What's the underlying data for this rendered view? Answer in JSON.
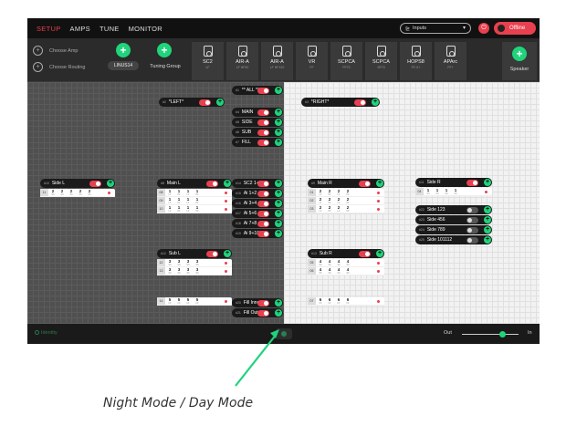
{
  "tabs": [
    {
      "label": "SETUP",
      "active": true
    },
    {
      "label": "AMPS",
      "active": false
    },
    {
      "label": "TUNE",
      "active": false
    },
    {
      "label": "MONITOR",
      "active": false
    }
  ],
  "header": {
    "inputs_select": "Inputs",
    "offline_label": "Offline"
  },
  "toolbar": {
    "choose_amp": "Choose Amp",
    "choose_routing": "Choose Routing",
    "linus_label": "LINUS14",
    "tuning_group": "Tuning Group",
    "speaker_label": "Speaker"
  },
  "speakers": [
    {
      "name": "SC2",
      "sub": "LF"
    },
    {
      "name": "AIR-A",
      "sub": "LF HF90"
    },
    {
      "name": "AIR-A",
      "sub": "LF HF120"
    },
    {
      "name": "VR",
      "sub": "FF"
    },
    {
      "name": "SCPCA",
      "sub": "FF70"
    },
    {
      "name": "SCPCA",
      "sub": "SF70"
    },
    {
      "name": "HOPS8",
      "sub": "FF-X+"
    },
    {
      "name": "APArc",
      "sub": "FF+"
    }
  ],
  "groups": {
    "all": {
      "num": "#1",
      "label": "** ALL **"
    },
    "left": {
      "num": "#2",
      "label": "*LEFT*"
    },
    "right": {
      "num": "#3",
      "label": "*RIGHT*"
    },
    "main": {
      "num": "#4",
      "label": "MAIN"
    },
    "side": {
      "num": "#5",
      "label": "SIDE"
    },
    "sub": {
      "num": "#6",
      "label": "SUB"
    },
    "fill": {
      "num": "#7",
      "label": "FILL"
    },
    "side_l": {
      "num": "#10",
      "label": "Side L"
    },
    "main_l": {
      "num": "#8",
      "label": "Main L"
    },
    "sc2_12": {
      "num": "#14",
      "label": "SC2 1+2"
    },
    "ai_12": {
      "num": "#15",
      "label": "Ai 1+2"
    },
    "ai_34": {
      "num": "#16",
      "label": "Ai 3+4"
    },
    "ai_56": {
      "num": "#17",
      "label": "Ai 5+6"
    },
    "ai_78": {
      "num": "#18",
      "label": "Ai 7+8"
    },
    "ai_910": {
      "num": "#19",
      "label": "Ai 9+10"
    },
    "main_r": {
      "num": "#9",
      "label": "Main R"
    },
    "side_r": {
      "num": "#11",
      "label": "Side R"
    },
    "side_123": {
      "num": "#22",
      "label": "Side 123"
    },
    "side_456": {
      "num": "#23",
      "label": "Side 456"
    },
    "side_789": {
      "num": "#24",
      "label": "Side 789"
    },
    "side_101112": {
      "num": "#25",
      "label": "Side 101112"
    },
    "sub_l": {
      "num": "#12",
      "label": "Sub L"
    },
    "sub_r": {
      "num": "#13",
      "label": "Sub R"
    },
    "fill_inner": {
      "num": "#20",
      "label": "Fill Inner"
    },
    "fill_outer": {
      "num": "#21",
      "label": "Fill Outer"
    }
  },
  "tables": {
    "side_l": [
      {
        "n": "11",
        "v": [
          "2",
          "2",
          "2",
          "2",
          "2"
        ],
        "s": [
          "SS",
          "SS",
          "SS",
          "SS",
          "SS"
        ]
      }
    ],
    "main_l": [
      {
        "n": "08",
        "v": [
          "1",
          "1",
          "1",
          "1"
        ],
        "s": [
          "LF",
          "HF",
          "LF",
          "HF"
        ]
      },
      {
        "n": "09",
        "v": [
          "1",
          "1",
          "1",
          "1"
        ],
        "s": [
          "LF",
          "HF",
          "LF",
          "HF"
        ]
      },
      {
        "n": "10",
        "v": [
          "1",
          "1",
          "1",
          "1"
        ],
        "s": [
          "LF",
          "HF",
          "LF",
          "HF"
        ]
      }
    ],
    "main_r": [
      {
        "n": "01",
        "v": [
          "2",
          "2",
          "2",
          "2"
        ],
        "s": [
          "LF",
          "HF",
          "LF",
          "HF"
        ]
      },
      {
        "n": "02",
        "v": [
          "2",
          "2",
          "2",
          "2"
        ],
        "s": [
          "LF",
          "HF",
          "LF",
          "HF"
        ]
      },
      {
        "n": "03",
        "v": [
          "2",
          "2",
          "2",
          "2"
        ],
        "s": [
          "LF",
          "HF",
          "LF",
          "HF"
        ]
      }
    ],
    "side_r": [
      {
        "n": "04",
        "v": [
          "1",
          "1",
          "1",
          "1"
        ],
        "s": [
          "SS",
          "SS",
          "SS",
          "SS"
        ]
      }
    ],
    "sub_l": [
      {
        "n": "12",
        "v": [
          "3",
          "3",
          "3",
          "3"
        ],
        "s": [
          "SS",
          "SS",
          "SS",
          "SS"
        ]
      },
      {
        "n": "13",
        "v": [
          "3",
          "3",
          "3",
          "3"
        ],
        "s": [
          "SS",
          "SS",
          "SS",
          "SS"
        ]
      }
    ],
    "sub_r": [
      {
        "n": "05",
        "v": [
          "4",
          "4",
          "4",
          "4"
        ],
        "s": [
          "SS",
          "SS",
          "SS",
          "SS"
        ]
      },
      {
        "n": "06",
        "v": [
          "4",
          "4",
          "4",
          "4"
        ],
        "s": [
          "SS",
          "SS",
          "SS",
          "SS"
        ]
      }
    ],
    "fill_l": [
      {
        "n": "14",
        "v": [
          "5",
          "5",
          "5",
          "5"
        ],
        "s": [
          "FF",
          "FF",
          "FF",
          "FF"
        ]
      }
    ],
    "fill_r": [
      {
        "n": "07",
        "v": [
          "6",
          "6",
          "6",
          "6"
        ],
        "s": [
          "FF",
          "FF",
          "FF",
          "FF"
        ]
      }
    ]
  },
  "status": {
    "identity": "Identity",
    "zoom_out": "Out",
    "zoom_in": "In",
    "zoom_level": 0.72
  },
  "annotation": "Night Mode / Day Mode",
  "colors": {
    "accent_red": "#e8404e",
    "accent_green": "#1fd47b"
  }
}
